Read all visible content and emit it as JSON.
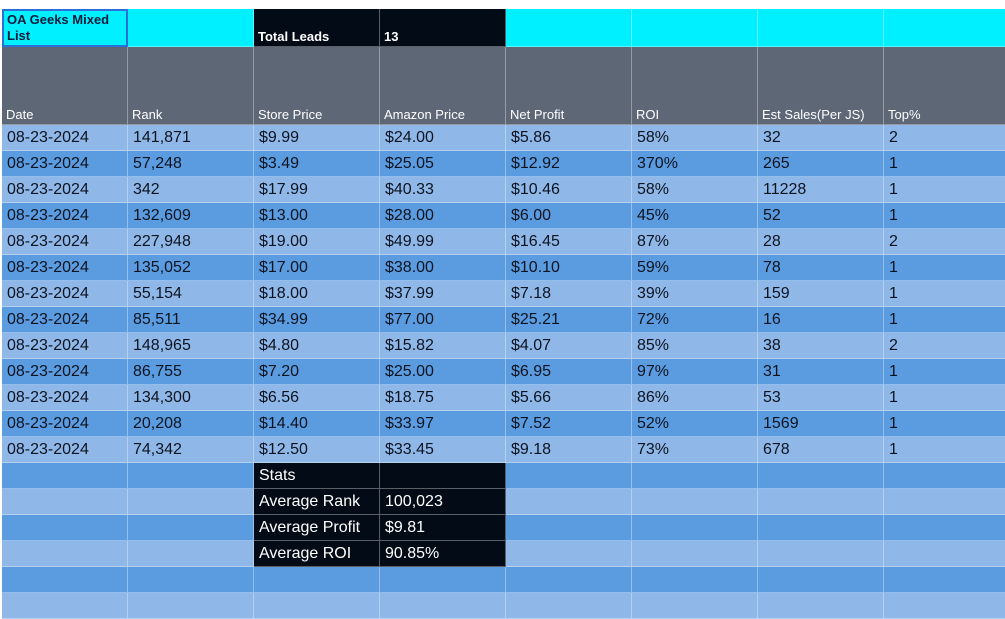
{
  "sheet": {
    "title": "OA Geeks Mixed List",
    "total_leads_label": "Total Leads",
    "total_leads_value": "13",
    "headers": [
      "Date",
      "Rank",
      "Store Price",
      "Amazon Price",
      "Net Profit",
      "ROI",
      "Est Sales(Per JS)",
      "Top%"
    ],
    "rows": [
      [
        "08-23-2024",
        "141,871",
        "$9.99",
        "$24.00",
        "$5.86",
        "58%",
        "32",
        "2"
      ],
      [
        "08-23-2024",
        "57,248",
        "$3.49",
        "$25.05",
        "$12.92",
        "370%",
        "265",
        "1"
      ],
      [
        "08-23-2024",
        "342",
        "$17.99",
        "$40.33",
        "$10.46",
        "58%",
        "11228",
        "1"
      ],
      [
        "08-23-2024",
        "132,609",
        "$13.00",
        "$28.00",
        "$6.00",
        "45%",
        "52",
        "1"
      ],
      [
        "08-23-2024",
        "227,948",
        "$19.00",
        "$49.99",
        "$16.45",
        "87%",
        "28",
        "2"
      ],
      [
        "08-23-2024",
        "135,052",
        "$17.00",
        "$38.00",
        "$10.10",
        "59%",
        "78",
        "1"
      ],
      [
        "08-23-2024",
        "55,154",
        "$18.00",
        "$37.99",
        "$7.18",
        "39%",
        "159",
        "1"
      ],
      [
        "08-23-2024",
        "85,511",
        "$34.99",
        "$77.00",
        "$25.21",
        "72%",
        "16",
        "1"
      ],
      [
        "08-23-2024",
        "148,965",
        "$4.80",
        "$15.82",
        "$4.07",
        "85%",
        "38",
        "2"
      ],
      [
        "08-23-2024",
        "86,755",
        "$7.20",
        "$25.00",
        "$6.95",
        "97%",
        "31",
        "1"
      ],
      [
        "08-23-2024",
        "134,300",
        "$6.56",
        "$18.75",
        "$5.66",
        "86%",
        "53",
        "1"
      ],
      [
        "08-23-2024",
        "20,208",
        "$14.40",
        "$33.97",
        "$7.52",
        "52%",
        "1569",
        "1"
      ],
      [
        "08-23-2024",
        "74,342",
        "$12.50",
        "$33.45",
        "$9.18",
        "73%",
        "678",
        "1"
      ]
    ],
    "stats": {
      "title": "Stats",
      "avg_rank_label": "Average Rank",
      "avg_rank_value": "100,023",
      "avg_profit_label": "Average Profit",
      "avg_profit_value": "$9.81",
      "avg_roi_label": "Average ROI",
      "avg_roi_value": "90.85%"
    }
  },
  "colors": {
    "cyan": "#00f0ff",
    "dark": "#030b16",
    "header_gray": "#5d6775",
    "row_light": "#8fb7e8",
    "row_dark": "#5b9be0",
    "title_border": "#2b6fd8"
  }
}
